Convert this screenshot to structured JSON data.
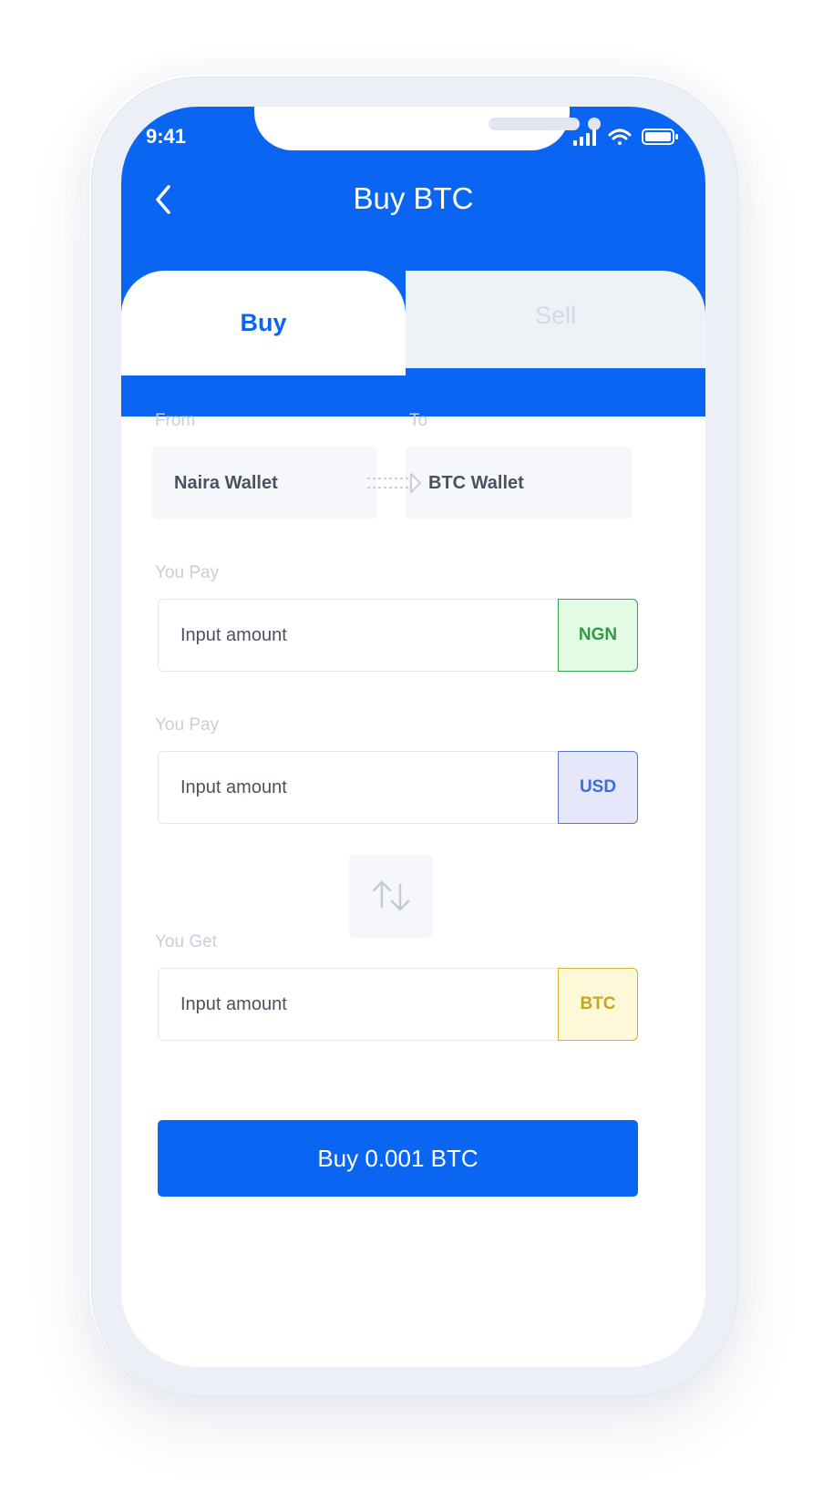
{
  "status_bar": {
    "time": "9:41",
    "icons": [
      "signal-icon",
      "wifi-icon",
      "battery-icon"
    ]
  },
  "header": {
    "title": "Buy BTC",
    "back_icon": "chevron-left-icon"
  },
  "tabs": {
    "buy": "Buy",
    "sell": "Sell",
    "active": "Buy"
  },
  "transfer": {
    "from_label": "From",
    "to_label": "To",
    "from_value": "Naira Wallet",
    "to_value": "BTC Wallet"
  },
  "fields": [
    {
      "label": "You Pay",
      "placeholder": "Input amount",
      "currency": "NGN"
    },
    {
      "label": "You Pay",
      "placeholder": "Input amount",
      "currency": "USD"
    },
    {
      "label": "You Get",
      "placeholder": "Input amount",
      "currency": "BTC"
    }
  ],
  "swap_icon": "swap-arrows-icon",
  "buy_button": "Buy 0.001 BTC",
  "colors": {
    "primary": "#0a66f2",
    "ngn_bg": "#e3fbe4",
    "ngn_text": "#2e9a45",
    "usd_bg": "#e6e7fb",
    "usd_text": "#3b6fd6",
    "btc_bg": "#fdf8d8",
    "btc_text": "#c9a418"
  }
}
